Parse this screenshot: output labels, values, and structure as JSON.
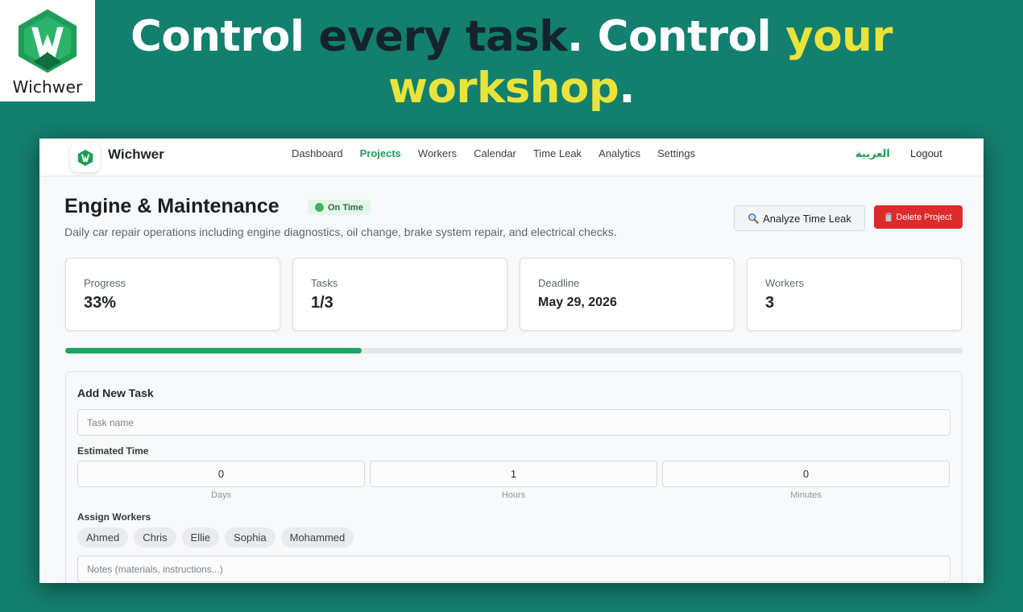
{
  "brand": {
    "name": "Wichwer",
    "colors": {
      "logo_green": "#1f9d58",
      "accent": "#e9e43a",
      "background": "#137f6e"
    }
  },
  "headline": {
    "part1": "Control ",
    "part2": "every task",
    "part3": ". Control ",
    "part4": "your workshop",
    "part5": "."
  },
  "navbar": {
    "brand": "Wichwer",
    "links": [
      {
        "label": "Dashboard",
        "active": false
      },
      {
        "label": "Projects",
        "active": true
      },
      {
        "label": "Workers",
        "active": false
      },
      {
        "label": "Calendar",
        "active": false
      },
      {
        "label": "Time Leak",
        "active": false
      },
      {
        "label": "Analytics",
        "active": false
      },
      {
        "label": "Settings",
        "active": false
      }
    ],
    "language": "العربية",
    "logout": "Logout"
  },
  "project": {
    "title": "Engine & Maintenance",
    "status": "On Time",
    "description": "Daily car repair operations including engine diagnostics, oil change, brake system repair, and electrical checks.",
    "analyze_label": "Analyze Time Leak",
    "delete_label": "Delete Project"
  },
  "stats": {
    "progress": {
      "label": "Progress",
      "value": "33%"
    },
    "tasks": {
      "label": "Tasks",
      "value": "1/3"
    },
    "deadline": {
      "label": "Deadline",
      "value": "May 29, 2026"
    },
    "workers": {
      "label": "Workers",
      "value": "3"
    }
  },
  "progress_fraction": 0.33,
  "add_task": {
    "title": "Add New Task",
    "task_name_placeholder": "Task name",
    "estimated_label": "Estimated Time",
    "days": {
      "value": "0",
      "label": "Days"
    },
    "hours": {
      "value": "1",
      "label": "Hours"
    },
    "minutes": {
      "value": "0",
      "label": "Minutes"
    },
    "assign_label": "Assign Workers",
    "workers": [
      "Ahmed",
      "Chris",
      "Ellie",
      "Sophia",
      "Mohammed"
    ],
    "notes_placeholder": "Notes (materials, instructions...)"
  }
}
